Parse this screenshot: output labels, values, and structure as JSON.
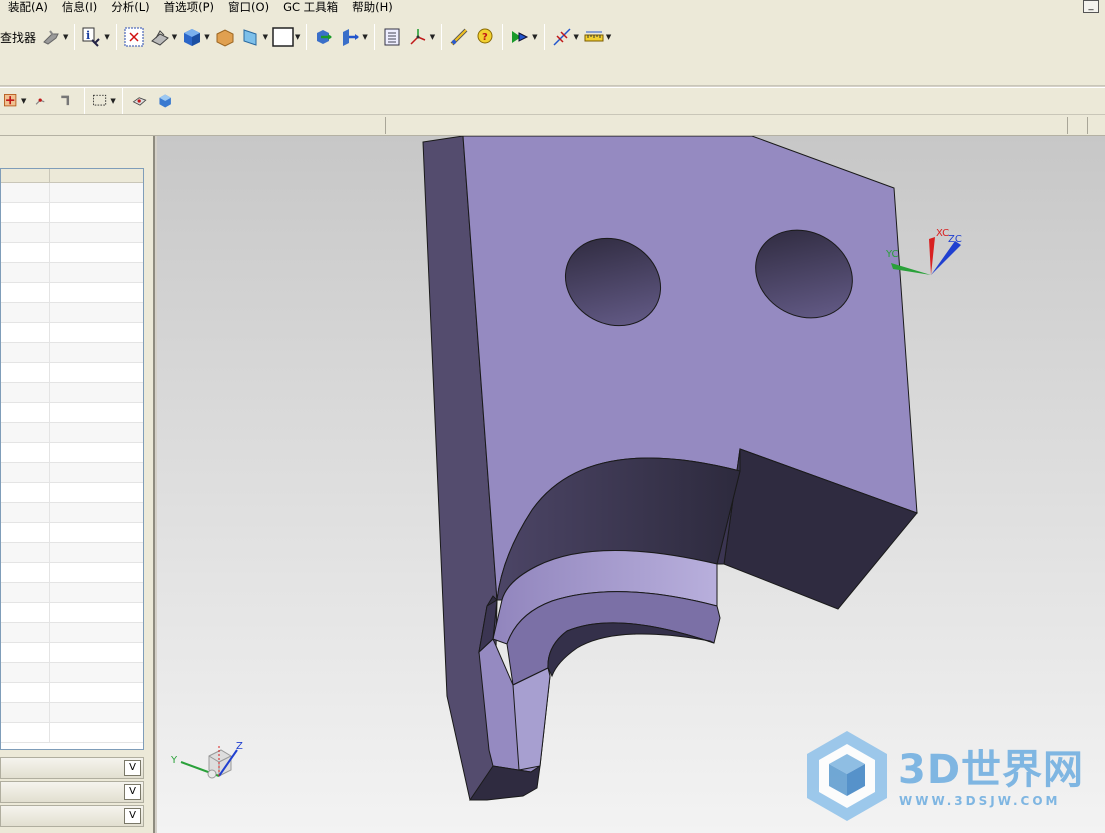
{
  "menu": {
    "items": [
      "装配(A)",
      "信息(I)",
      "分析(L)",
      "首选项(P)",
      "窗口(O)",
      "GC 工具箱",
      "帮助(H)"
    ]
  },
  "toolbar": {
    "finder_label": "查找器"
  },
  "triad": {
    "xc": "XC",
    "yc": "YC",
    "zc": "ZC"
  },
  "view_triad": {
    "y": "Y",
    "z": "Z"
  },
  "watermark": {
    "brand": "3D世界网",
    "url": "WWW.3DSJW.COM"
  },
  "colors": {
    "part_face": "#958ac1",
    "part_side": "#544c6e",
    "part_dark": "#2e2a3e",
    "accent_blue": "#7fb6e2"
  }
}
